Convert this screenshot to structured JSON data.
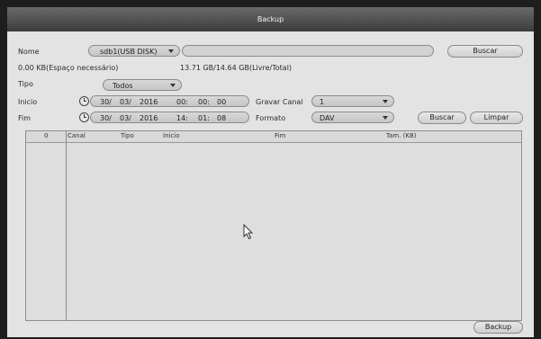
{
  "window": {
    "title": "Backup"
  },
  "device": {
    "label": "Nome",
    "selected": "sdb1(USB DISK)",
    "path_value": "",
    "search_label": "Buscar"
  },
  "space": {
    "required": "0.00 KB(Espaço necessário)",
    "free_total": "13.71 GB/14.64 GB(Livre/Total)"
  },
  "type": {
    "label": "Tipo",
    "selected": "Todos"
  },
  "start": {
    "label": "Inicio",
    "day": "30/",
    "month": "03/",
    "year": "2016",
    "hour": "00:",
    "minute": "00:",
    "second": "00"
  },
  "end": {
    "label": "Fim",
    "day": "30/",
    "month": "03/",
    "year": "2016",
    "hour": "14:",
    "minute": "01:",
    "second": "08"
  },
  "channel": {
    "label": "Gravar Canal",
    "selected": "1"
  },
  "format": {
    "label": "Formato",
    "selected": "DAV"
  },
  "actions": {
    "search": "Buscar",
    "clear": "Limpar",
    "backup": "Backup"
  },
  "table": {
    "headers": {
      "count": "0",
      "channel": "Canal",
      "type": "Tipo",
      "start": "Inicio",
      "end": "Fim",
      "size": "Tam. (KB)"
    },
    "rows": []
  },
  "icons": {
    "clock": "clock-icon",
    "caret": "chevron-down-icon",
    "pointer": "mouse-pointer-icon"
  }
}
